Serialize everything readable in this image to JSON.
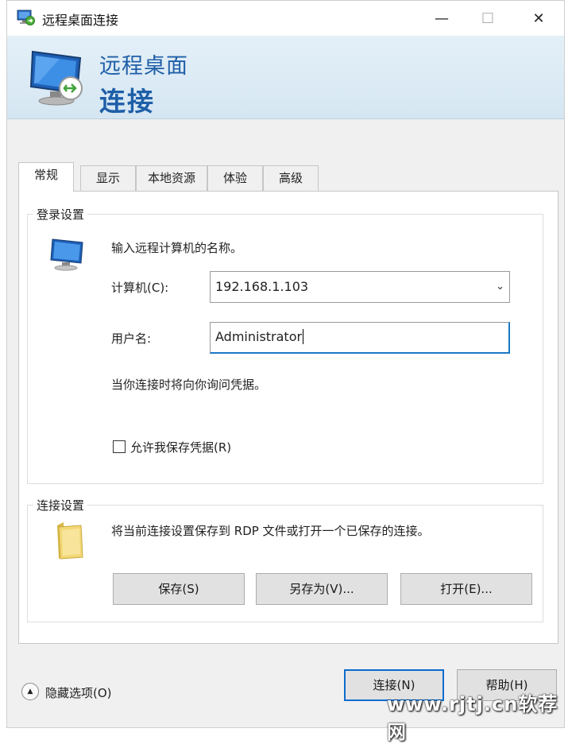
{
  "window": {
    "title": "远程桌面连接",
    "minimize_glyph": "—",
    "maximize_glyph": "☐",
    "close_glyph": "✕"
  },
  "banner": {
    "line1": "远程桌面",
    "line2": "连接"
  },
  "tabs": [
    {
      "label": "常规",
      "active": true
    },
    {
      "label": "显示",
      "active": false
    },
    {
      "label": "本地资源",
      "active": false
    },
    {
      "label": "体验",
      "active": false
    },
    {
      "label": "高级",
      "active": false
    }
  ],
  "logon": {
    "group_title": "登录设置",
    "prompt": "输入远程计算机的名称。",
    "computer_label": "计算机(C):",
    "computer_value": "192.168.1.103",
    "username_label": "用户名:",
    "username_value": "Administrator",
    "credentials_note": "当你连接时将向你询问凭据。",
    "save_credentials_label": "允许我保存凭据(R)",
    "save_credentials_checked": false
  },
  "connection": {
    "group_title": "连接设置",
    "description": "将当前连接设置保存到 RDP 文件或打开一个已保存的连接。",
    "save_button": "保存(S)",
    "save_as_button": "另存为(V)...",
    "open_button": "打开(E)..."
  },
  "footer": {
    "hide_options": "隐藏选项(O)",
    "connect_button": "连接(N)",
    "help_button": "帮助(H)"
  },
  "watermark": "www.rjtj.cn软荐网",
  "icons": {
    "app": "remote-desktop-icon",
    "monitor": "computer-monitor-icon",
    "folder": "folder-icon",
    "chevron": "chevron-down-icon",
    "collapse": "chevron-up-icon"
  },
  "colors": {
    "banner_text": "#1f5fa8",
    "focus_border": "#1b78c6",
    "window_bg": "#f0f0f0"
  }
}
